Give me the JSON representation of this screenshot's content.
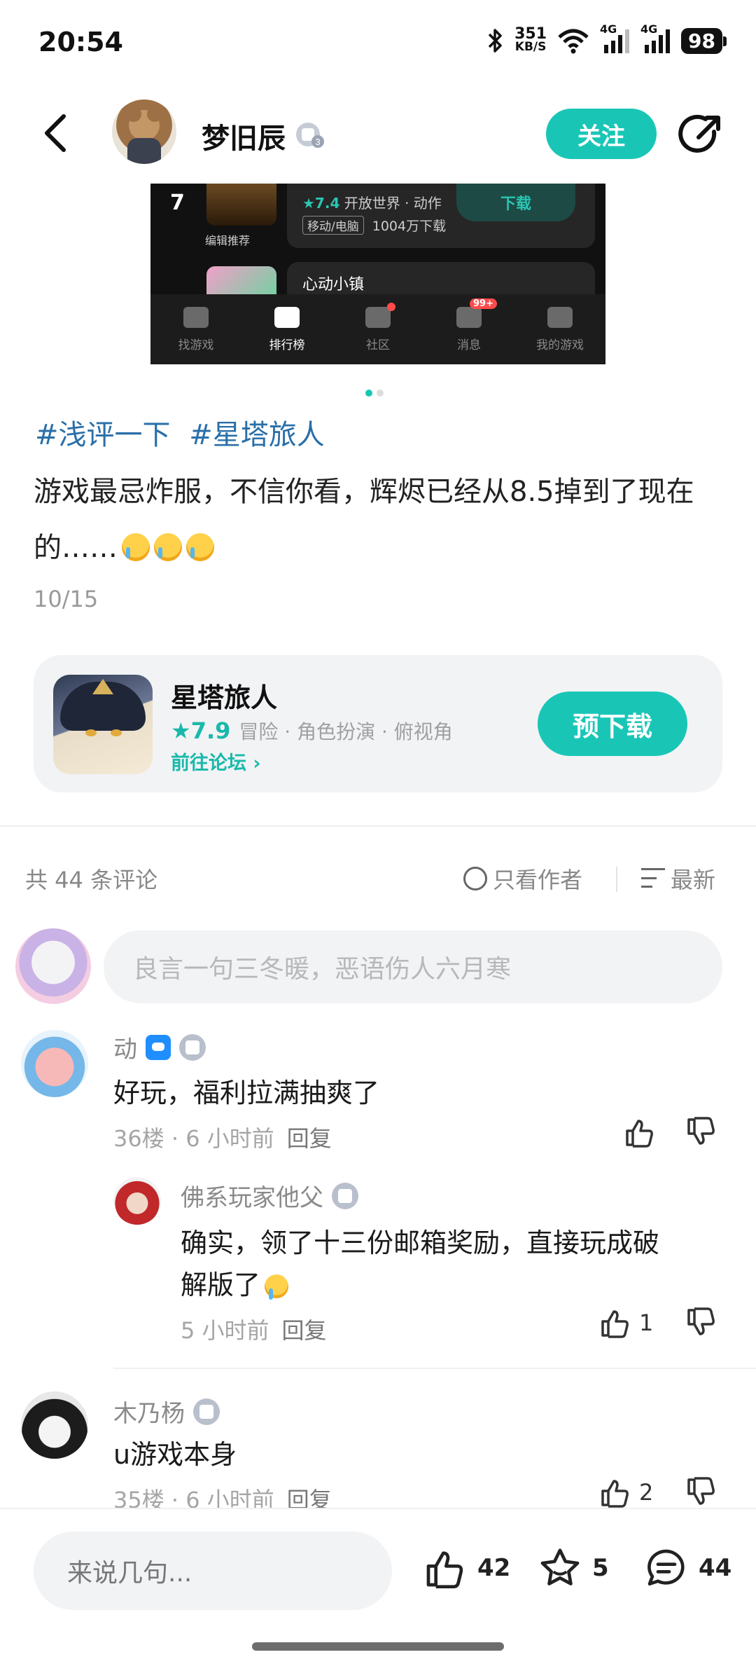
{
  "status": {
    "time": "20:54",
    "net_speed_value": "351",
    "net_speed_unit": "KB/S",
    "signal1": "4G",
    "signal2": "4G",
    "battery": "98"
  },
  "header": {
    "username": "梦旧辰",
    "level_badge": "3",
    "follow_label": "关注"
  },
  "embedded_screenshot": {
    "rank": "7",
    "editor_tag": "编辑推荐",
    "rating": "★7.4",
    "genres": "开放世界 · 动作",
    "platform_tag": "移动/电脑",
    "downloads": "1004万下载",
    "download_btn": "下载",
    "next_game_name": "心动小镇",
    "tabs": [
      {
        "label": "找游戏"
      },
      {
        "label": "排行榜"
      },
      {
        "label": "社区"
      },
      {
        "label": "消息",
        "badge": "99+"
      },
      {
        "label": "我的游戏"
      }
    ]
  },
  "post": {
    "tags": [
      "#浅评一下",
      "#星塔旅人"
    ],
    "text": "游戏最忌炸服，不信你看，辉烬已经从8.5掉到了现在的……",
    "date": "10/15"
  },
  "game_card": {
    "name": "星塔旅人",
    "score": "7.9",
    "genres": "冒险 · 角色扮演 · 俯视角",
    "forum_link": "前往论坛 ›",
    "predownload_label": "预下载"
  },
  "comments_header": {
    "count_text": "共 44 条评论",
    "only_author": "只看作者",
    "sort": "最新"
  },
  "comment_input": {
    "placeholder": "良言一句三冬暖，恶语伤人六月寒"
  },
  "comments": [
    {
      "author": "动",
      "text": "好玩，福利拉满抽爽了",
      "floor_time": "36楼 · 6 小时前",
      "reply": "回复",
      "likes": ""
    },
    {
      "author": "佛系玩家他父",
      "text_line1": "确实，领了十三份邮箱奖励，直接玩成破",
      "text_line2": "解版了",
      "time": "5 小时前",
      "reply": "回复",
      "likes": "1"
    },
    {
      "author": "木乃杨",
      "text": "u游戏本身",
      "floor_time": "35楼 · 6 小时前",
      "reply": "回复",
      "likes": "2"
    }
  ],
  "bottom_bar": {
    "input_placeholder": "来说几句...",
    "likes": "42",
    "favorites": "5",
    "comments": "44"
  },
  "colors": {
    "accent": "#19c6b6",
    "tag_blue": "#2a6fa8"
  }
}
